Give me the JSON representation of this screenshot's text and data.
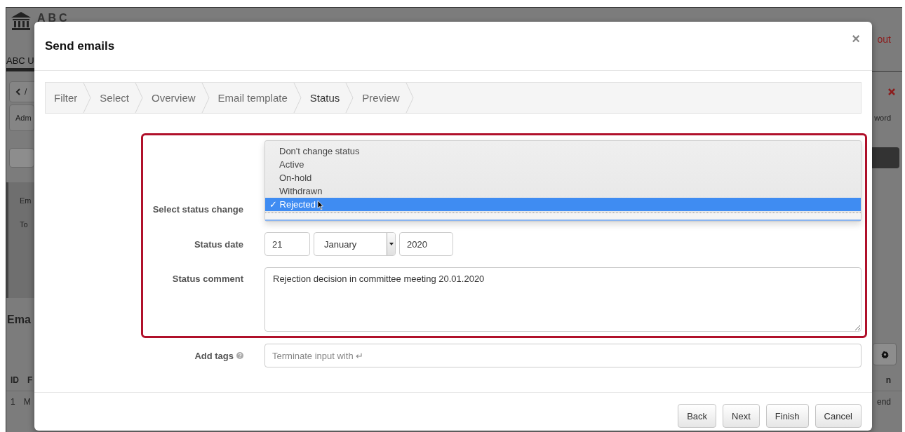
{
  "background_page": {
    "logo_text": "ABC",
    "tab": "ABC U",
    "breadcrumb": "/",
    "left_texts": [
      "Adm",
      "Em",
      "To"
    ],
    "heading": "Ema",
    "table_header": [
      "ID",
      "F"
    ],
    "table_row": [
      "1",
      "M"
    ],
    "logout": "out",
    "right_texts": [
      "word",
      "n",
      "end"
    ]
  },
  "modal": {
    "title": "Send emails",
    "close": "×",
    "steps": [
      {
        "label": "Filter",
        "selected": false
      },
      {
        "label": "Select",
        "selected": false
      },
      {
        "label": "Overview",
        "selected": false
      },
      {
        "label": "Email template",
        "selected": false
      },
      {
        "label": "Status",
        "selected": true
      },
      {
        "label": "Preview",
        "selected": false
      }
    ],
    "status_change": {
      "label": "Select status change",
      "check_mark": "✓",
      "options": [
        {
          "label": "Don't change status",
          "selected": false
        },
        {
          "label": "Active",
          "selected": false
        },
        {
          "label": "On-hold",
          "selected": false
        },
        {
          "label": "Withdrawn",
          "selected": false
        },
        {
          "label": "Rejected",
          "selected": true
        }
      ]
    },
    "status_date": {
      "label": "Status date",
      "day": "21",
      "month": "January",
      "year": "2020"
    },
    "status_comment": {
      "label": "Status comment",
      "value": "Rejection decision in committee meeting 20.01.2020"
    },
    "tags": {
      "label": "Add tags",
      "placeholder": "Terminate input with ↵"
    },
    "buttons": [
      "Back",
      "Next",
      "Finish",
      "Cancel"
    ]
  }
}
